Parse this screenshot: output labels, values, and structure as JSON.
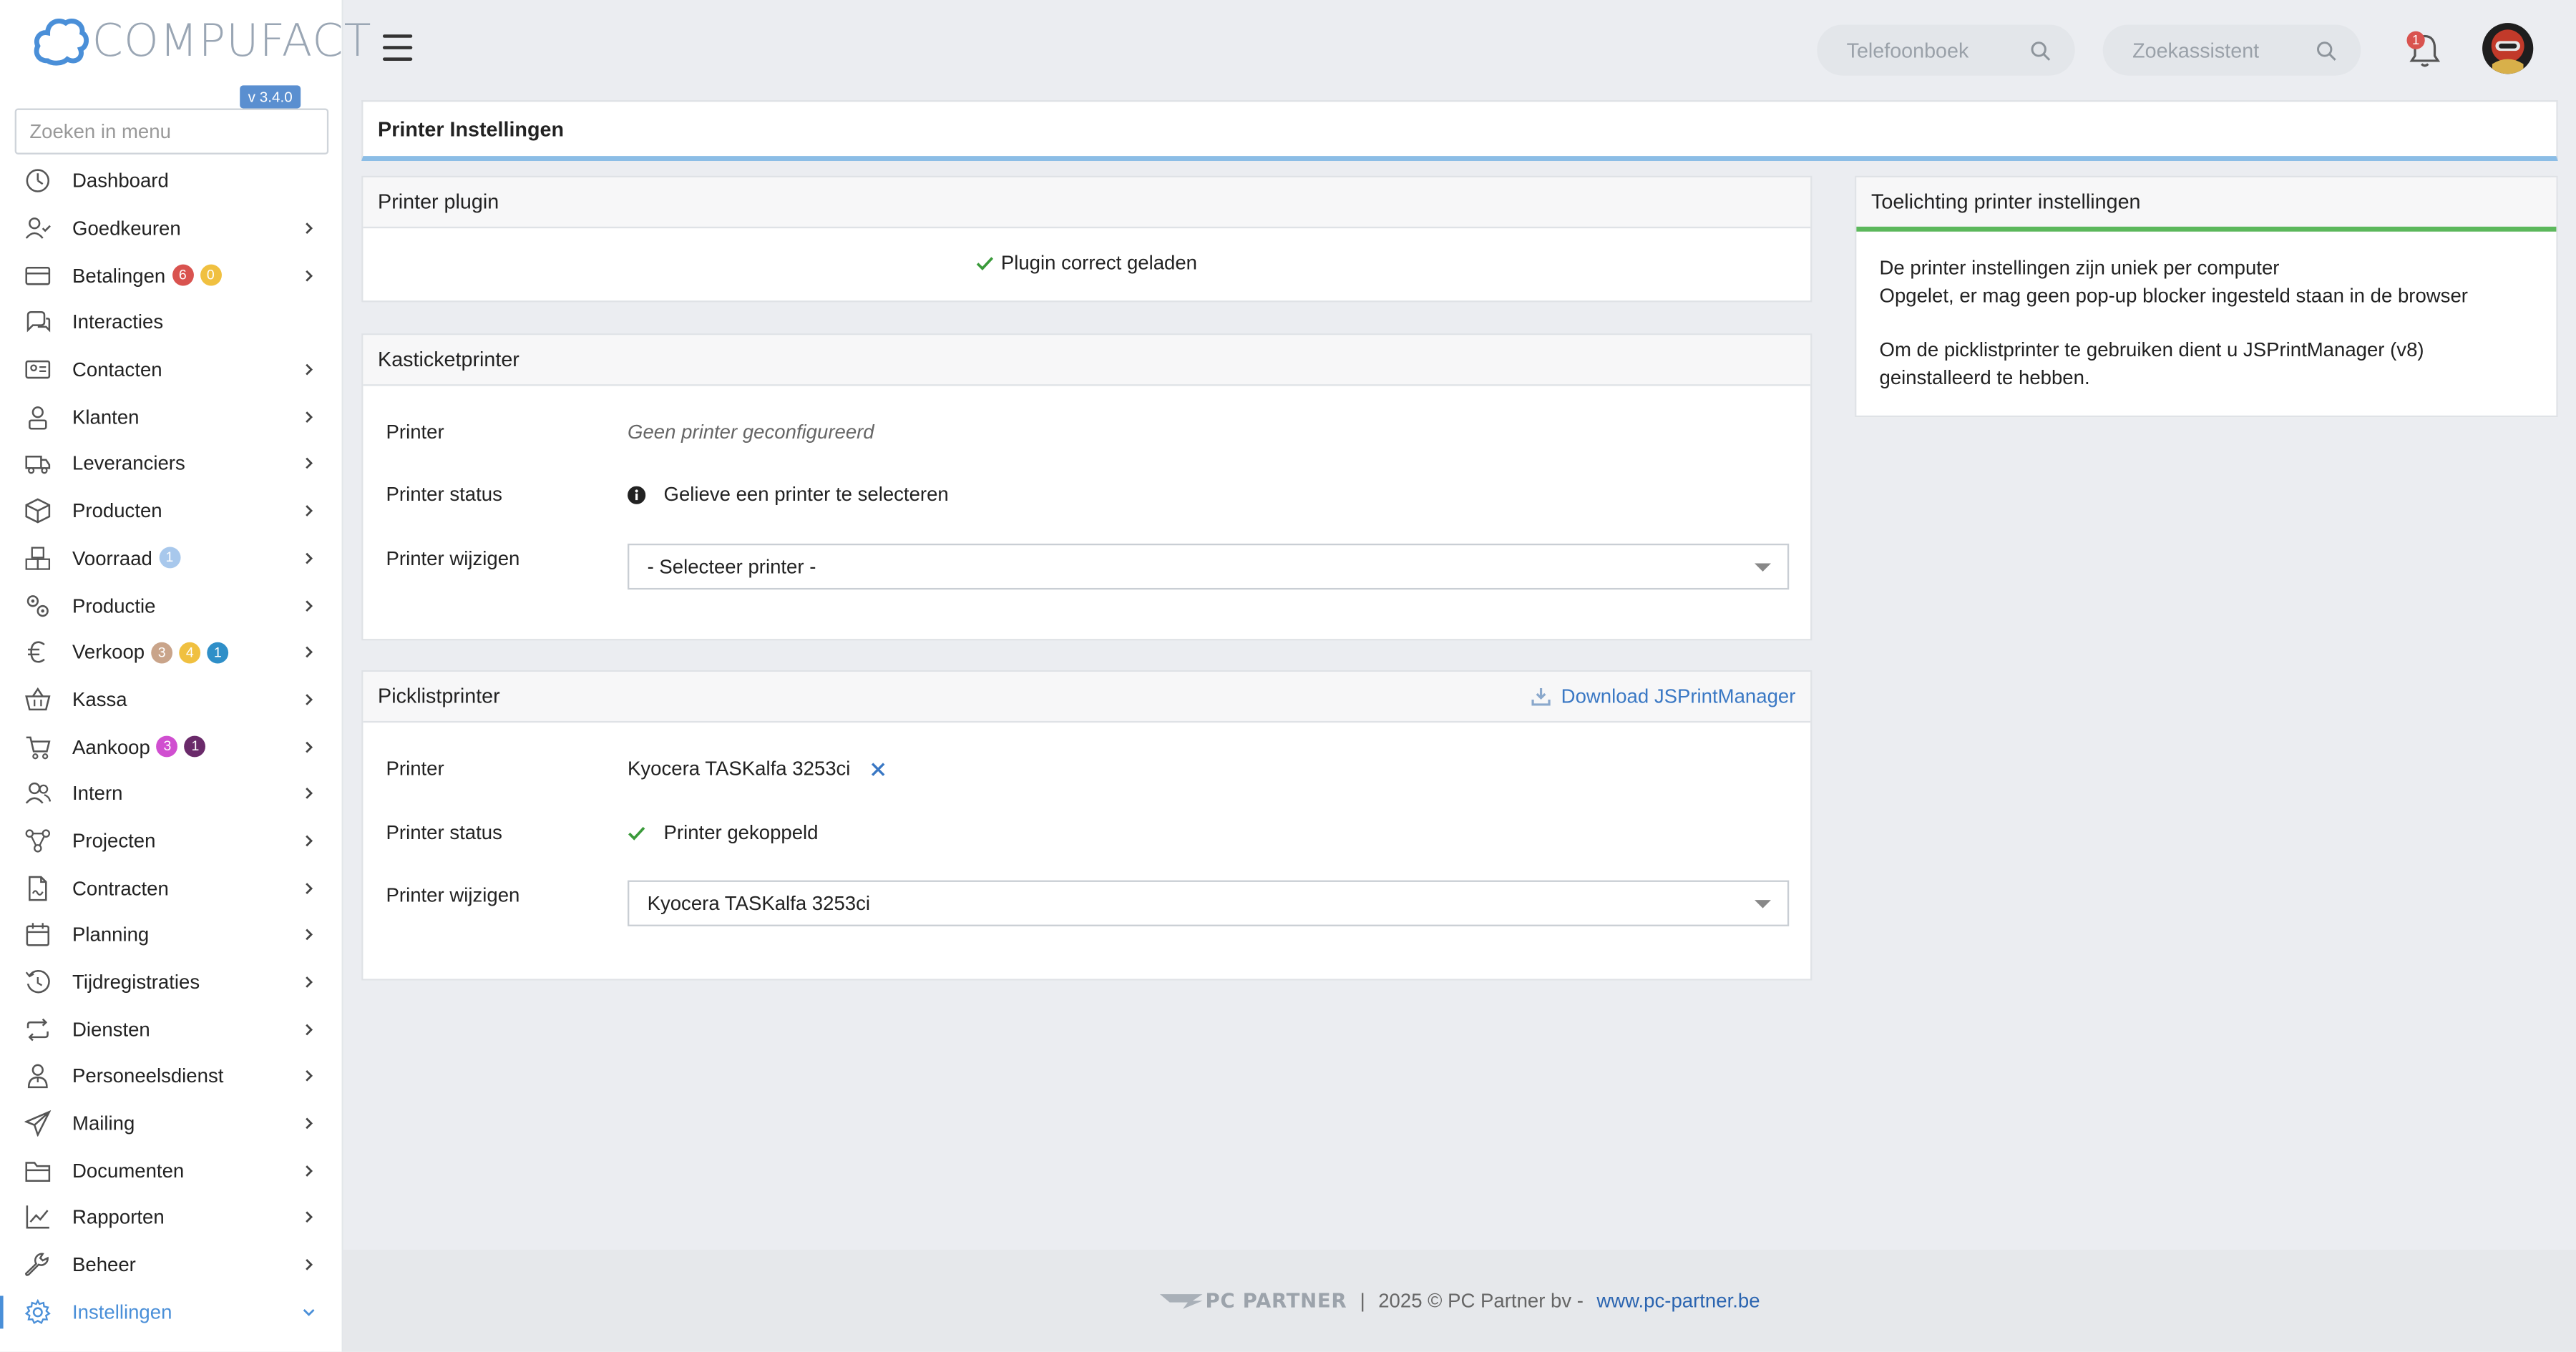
{
  "brand": {
    "name": "COMPUFACT",
    "version": "v 3.4.0"
  },
  "menu_search": {
    "placeholder": "Zoeken in menu"
  },
  "sidebar": {
    "items": [
      {
        "label": "Dashboard",
        "icon": "dashboard-icon",
        "chevron": false,
        "badges": []
      },
      {
        "label": "Goedkeuren",
        "icon": "user-check-icon",
        "chevron": true,
        "badges": []
      },
      {
        "label": "Betalingen",
        "icon": "credit-card-icon",
        "chevron": true,
        "badges": [
          {
            "value": "6",
            "color": "#d9534f"
          },
          {
            "value": "0",
            "color": "#f0c040"
          }
        ]
      },
      {
        "label": "Interacties",
        "icon": "chat-icon",
        "chevron": false,
        "badges": []
      },
      {
        "label": "Contacten",
        "icon": "contact-card-icon",
        "chevron": true,
        "badges": []
      },
      {
        "label": "Klanten",
        "icon": "customer-icon",
        "chevron": true,
        "badges": []
      },
      {
        "label": "Leveranciers",
        "icon": "truck-icon",
        "chevron": true,
        "badges": []
      },
      {
        "label": "Producten",
        "icon": "box-icon",
        "chevron": true,
        "badges": []
      },
      {
        "label": "Voorraad",
        "icon": "boxes-icon",
        "chevron": true,
        "badges": [
          {
            "value": "1",
            "color": "#a8c8ec"
          }
        ]
      },
      {
        "label": "Productie",
        "icon": "gears-icon",
        "chevron": true,
        "badges": []
      },
      {
        "label": "Verkoop",
        "icon": "euro-icon",
        "chevron": true,
        "badges": [
          {
            "value": "3",
            "color": "#c9a48a"
          },
          {
            "value": "4",
            "color": "#f0c040"
          },
          {
            "value": "1",
            "color": "#2f8fc8"
          }
        ]
      },
      {
        "label": "Kassa",
        "icon": "basket-icon",
        "chevron": true,
        "badges": []
      },
      {
        "label": "Aankoop",
        "icon": "cart-icon",
        "chevron": true,
        "badges": [
          {
            "value": "3",
            "color": "#d04fd0"
          },
          {
            "value": "1",
            "color": "#6a2a6a"
          }
        ]
      },
      {
        "label": "Intern",
        "icon": "users-icon",
        "chevron": true,
        "badges": []
      },
      {
        "label": "Projecten",
        "icon": "project-icon",
        "chevron": true,
        "badges": []
      },
      {
        "label": "Contracten",
        "icon": "contract-icon",
        "chevron": true,
        "badges": []
      },
      {
        "label": "Planning",
        "icon": "calendar-icon",
        "chevron": true,
        "badges": []
      },
      {
        "label": "Tijdregistraties",
        "icon": "history-icon",
        "chevron": true,
        "badges": []
      },
      {
        "label": "Diensten",
        "icon": "repeat-icon",
        "chevron": true,
        "badges": []
      },
      {
        "label": "Personeelsdienst",
        "icon": "staff-icon",
        "chevron": true,
        "badges": []
      },
      {
        "label": "Mailing",
        "icon": "paper-plane-icon",
        "chevron": true,
        "badges": []
      },
      {
        "label": "Documenten",
        "icon": "folder-icon",
        "chevron": true,
        "badges": []
      },
      {
        "label": "Rapporten",
        "icon": "line-chart-icon",
        "chevron": true,
        "badges": []
      },
      {
        "label": "Beheer",
        "icon": "wrench-icon",
        "chevron": true,
        "badges": []
      },
      {
        "label": "Instellingen",
        "icon": "gear-icon",
        "chevron": true,
        "active": true,
        "badges": []
      }
    ]
  },
  "topbar": {
    "phonebook_placeholder": "Telefoonboek",
    "assistant_placeholder": "Zoekassistent",
    "notifications_count": "1"
  },
  "page": {
    "title": "Printer Instellingen"
  },
  "plugin_panel": {
    "title": "Printer plugin",
    "status": "Plugin correct geladen"
  },
  "receipt_panel": {
    "title": "Kasticketprinter",
    "printer_label": "Printer",
    "printer_value": "Geen printer geconfigureerd",
    "status_label": "Printer status",
    "status_value": "Gelieve een printer te selecteren",
    "change_label": "Printer wijzigen",
    "select_value": "- Selecteer printer -"
  },
  "picklist_panel": {
    "title": "Picklistprinter",
    "download_label": "Download JSPrintManager",
    "printer_label": "Printer",
    "printer_value": "Kyocera TASKalfa 3253ci",
    "status_label": "Printer status",
    "status_value": "Printer gekoppeld",
    "change_label": "Printer wijzigen",
    "select_value": "Kyocera TASKalfa 3253ci"
  },
  "help_panel": {
    "title": "Toelichting printer instellingen",
    "line1": "De printer instellingen zijn uniek per computer",
    "line2": "Opgelet, er mag geen pop-up blocker ingesteld staan in de browser",
    "line3": "Om de picklistprinter te gebruiken dient u JSPrintManager (v8) geinstalleerd te hebben."
  },
  "footer": {
    "brand": "PC PARTNER",
    "separator": "|",
    "copyright": "2025 © PC Partner bv -",
    "link": "www.pc-partner.be"
  },
  "colors": {
    "accent": "#4a8fd8",
    "title_underline": "#8bbde6",
    "help_underline": "#5cb85c",
    "success": "#3a9a3a",
    "link": "#3a78c4"
  }
}
